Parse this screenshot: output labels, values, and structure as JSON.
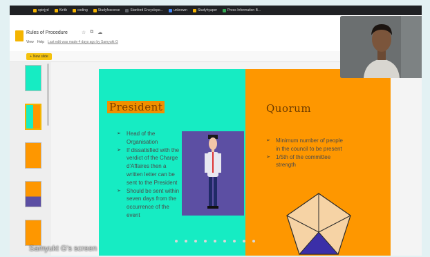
{
  "bookmarks": [
    {
      "label": "spinjyd",
      "color": "#f4b400"
    },
    {
      "label": "Kiritb",
      "color": "#f4b400"
    },
    {
      "label": "coding",
      "color": "#f4b400"
    },
    {
      "label": "Studyfoscorse",
      "color": "#f4b400"
    },
    {
      "label": "Stanford Encyclope...",
      "color": "#5f6368"
    },
    {
      "label": "unknown",
      "color": "#4285f4"
    },
    {
      "label": "Studyhyaper",
      "color": "#f4b400"
    },
    {
      "label": "Press Information B...",
      "color": "#34a853"
    }
  ],
  "doc": {
    "title": "Rules of Procedure",
    "menu": [
      "View",
      "Help"
    ],
    "last_edit": "Last edit was made 4 days ago by Samyukt G",
    "new_slide_label": "New slide"
  },
  "slide": {
    "left_heading": "President",
    "left_bullets": [
      "Head of the Organisation",
      "If dissatisfied with the verdict of the Charge d'Affaires then a written letter can be sent to the President",
      "Should be sent within seven days from the occurrence of the event"
    ],
    "right_heading": "Quorum",
    "right_bullets": [
      "Minimum number of people in the council to be present",
      "1/5th of the committee strength"
    ]
  },
  "share_label": "Samyukt G's screen",
  "colors": {
    "slide_left_bg": "#16ecc3",
    "slide_right_bg": "#fe9700",
    "accent": "#f4b400"
  }
}
